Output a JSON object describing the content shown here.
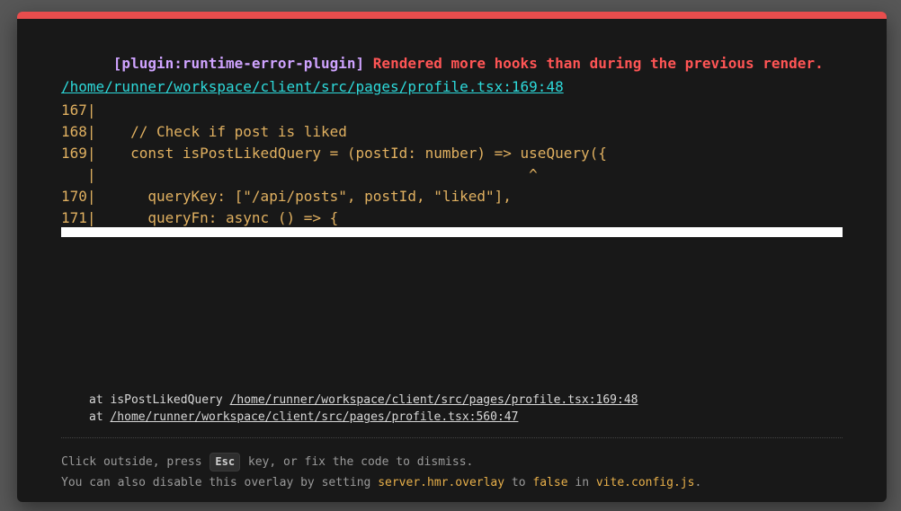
{
  "error": {
    "plugin": "[plugin:runtime-error-plugin]",
    "message": "Rendered more hooks than during the previous render."
  },
  "file_link": "/home/runner/workspace/client/src/pages/profile.tsx:169:48",
  "code_frame": [
    "167|",
    "168|    // Check if post is liked",
    "169|    const isPostLikedQuery = (postId: number) => useQuery({",
    "   |                                                  ^",
    "170|      queryKey: [\"/api/posts\", postId, \"liked\"],",
    "171|      queryFn: async () => {"
  ],
  "stack": [
    {
      "prefix": "at isPostLikedQuery ",
      "link": "/home/runner/workspace/client/src/pages/profile.tsx:169:48"
    },
    {
      "prefix": "at ",
      "link": "/home/runner/workspace/client/src/pages/profile.tsx:560:47"
    }
  ],
  "tip": {
    "line1_before": "Click outside, press ",
    "key": "Esc",
    "line1_after": " key, or fix the code to dismiss.",
    "line2_before": "You can also disable this overlay by setting ",
    "setting": "server.hmr.overlay",
    "line2_mid": " to ",
    "value": "false",
    "line2_mid2": " in ",
    "config_file": "vite.config.js",
    "line2_end": "."
  },
  "colors": {
    "accent_border": "#e84d4d",
    "plugin": "#cfa3ff",
    "message": "#ff5555",
    "link": "#2dd9da",
    "code": "#e0b060"
  }
}
